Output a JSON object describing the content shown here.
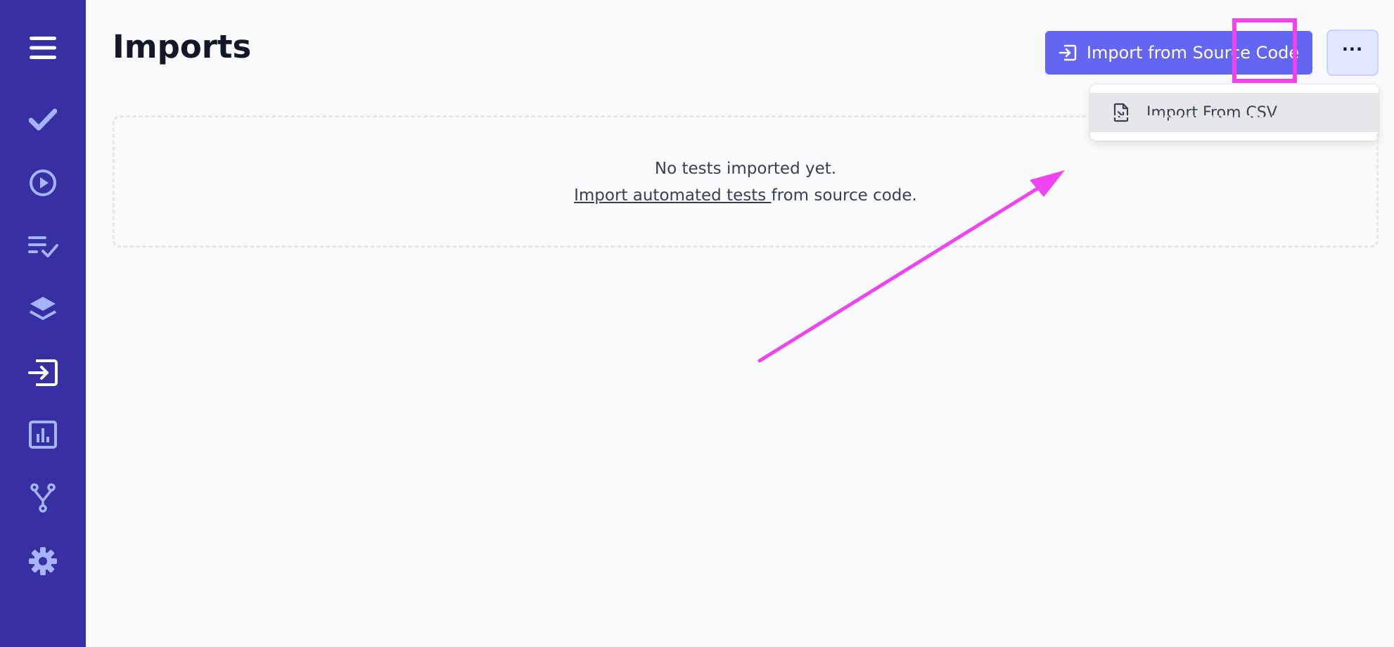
{
  "header": {
    "title": "Imports",
    "primary_button_label": "Import from Source Code",
    "more_button_label": "···"
  },
  "dropdown": {
    "items": [
      {
        "label": "Import From CSV",
        "icon": "file-import-icon"
      }
    ]
  },
  "empty_state": {
    "line1": "No tests imported yet.",
    "link_text": "Import automated tests ",
    "line2_rest": "from source code."
  },
  "sidebar": {
    "items": [
      {
        "icon": "menu-icon",
        "active": true
      },
      {
        "icon": "check-icon"
      },
      {
        "icon": "play-circle-icon"
      },
      {
        "icon": "list-check-icon"
      },
      {
        "icon": "layers-icon"
      },
      {
        "icon": "import-icon",
        "active": true
      },
      {
        "icon": "chart-bar-icon"
      },
      {
        "icon": "branch-icon"
      },
      {
        "icon": "gear-icon"
      }
    ]
  },
  "colors": {
    "sidebar_bg": "#3730a3",
    "sidebar_icon": "#a5b4fc",
    "sidebar_icon_active": "#ffffff",
    "primary": "#6366f1",
    "annotation": "#f043f0"
  }
}
